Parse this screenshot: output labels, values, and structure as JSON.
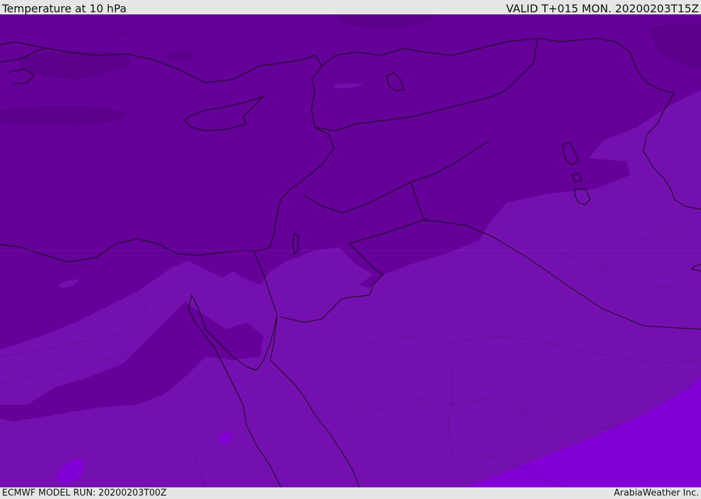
{
  "header": {
    "title": "Temperature at 10 hPa",
    "valid_time": "VALID T+015 MON. 20200203T15Z"
  },
  "footer": {
    "model_run": "ECMWF MODEL RUN: 20200203T00Z",
    "credit": "ArabiaWeather Inc."
  },
  "map": {
    "colors": {
      "darkest": "#5c008c",
      "dark": "#650099",
      "mid": "#7510b0",
      "light": "#8200d6",
      "border": "#111111"
    }
  }
}
